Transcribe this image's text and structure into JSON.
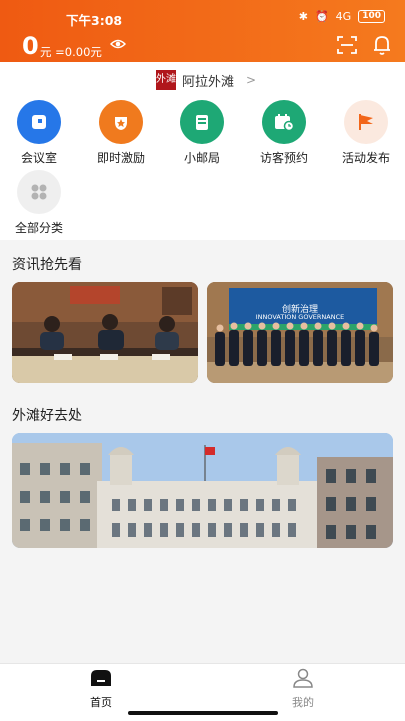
{
  "status": {
    "time": "下午3:08",
    "battery": "100",
    "signal": "4G"
  },
  "header": {
    "balance_value": "0",
    "balance_unit": "元 =0.00元"
  },
  "location": {
    "logo_text": "外滩",
    "name": "阿拉外滩",
    "arrow": ">"
  },
  "features": [
    {
      "label": "会议室",
      "icon": "meeting-room-icon",
      "color": "#2677e8"
    },
    {
      "label": "即时激励",
      "icon": "reward-icon",
      "color": "#f07a1e"
    },
    {
      "label": "小邮局",
      "icon": "post-office-icon",
      "color": "#1ea875"
    },
    {
      "label": "访客预约",
      "icon": "visitor-booking-icon",
      "color": "#1ea875"
    },
    {
      "label": "活动发布",
      "icon": "event-publish-icon",
      "color": "#fbe9df"
    },
    {
      "label": "全部分类",
      "icon": "all-categories-icon",
      "color": "#efefef"
    }
  ],
  "news": {
    "title": "资讯抢先看",
    "banner_text_cn": "创新治理",
    "banner_text_en": "INNOVATION GOVERNANCE"
  },
  "spots": {
    "title": "外滩好去处"
  },
  "tabbar": {
    "home_label": "首页",
    "mine_label": "我的"
  },
  "colors": {
    "brand": "#f2661a",
    "active_tab": "#111111",
    "inactive_tab": "#888888"
  }
}
